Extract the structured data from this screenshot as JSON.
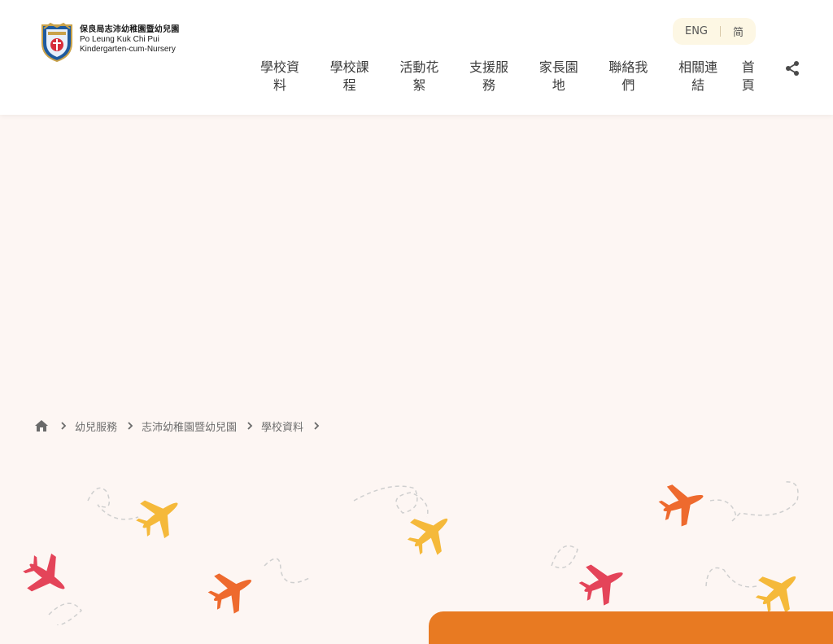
{
  "school": {
    "name_zh": "保良局志沛幼稚園暨幼兒園",
    "name_en_line1": "Po Leung Kuk Chi Pui",
    "name_en_line2": "Kindergarten-cum-Nursery"
  },
  "lang": {
    "eng": "ENG",
    "sc": "简"
  },
  "nav": [
    {
      "label": "學校資料"
    },
    {
      "label": "學校課程"
    },
    {
      "label": "活動花絮"
    },
    {
      "label": "支援服務"
    },
    {
      "label": "家長園地"
    },
    {
      "label": "聯絡我們"
    },
    {
      "label": "相關連結"
    },
    {
      "label": "首頁"
    }
  ],
  "breadcrumb": [
    {
      "label": "幼兒服務"
    },
    {
      "label": "志沛幼稚園暨幼兒園"
    },
    {
      "label": "學校資料"
    }
  ],
  "colors": {
    "background": "#fdf6f3",
    "accent_orange": "#e87a22",
    "lang_bg": "#fdf7e4",
    "plane_yellow": "#f5b93a",
    "plane_orange": "#ee6a2e",
    "plane_red": "#e44459"
  },
  "icons": [
    "school-crest-logo",
    "share-icon",
    "home-icon",
    "chevron-right-icon",
    "airplane-icon"
  ]
}
